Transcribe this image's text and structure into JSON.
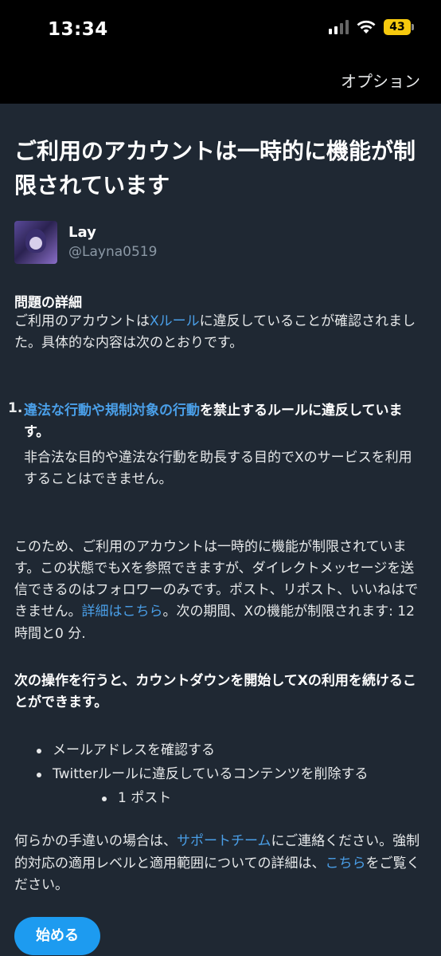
{
  "status": {
    "time": "13:34",
    "battery": "43"
  },
  "header": {
    "options_label": "オプション"
  },
  "title": "ご利用のアカウントは一時的に機能が制限されています",
  "profile": {
    "display_name": "Lay",
    "handle": "@Layna0519"
  },
  "details": {
    "heading": "問題の詳細",
    "text_before": "ご利用のアカウントは",
    "rules_link": "Xルール",
    "text_after": "に違反していることが確認されました。具体的な内容は次のとおりです。"
  },
  "violation": {
    "number": "1.",
    "link": "違法な行動や規制対象の行動",
    "strong_rest": "を禁止するルールに違反しています。",
    "description": "非合法な目的や違法な行動を助長する目的でXのサービスを利用することはできません。"
  },
  "restriction": {
    "text_before": "このため、ご利用のアカウントは一時的に機能が制限されています。この状態でもXを参照できますが、ダイレクトメッセージを送信できるのはフォロワーのみです。ポスト、リポスト、いいねはできません。",
    "details_link": "詳細はこちら",
    "text_after": "。次の期間、Xの機能が制限されます: 12 時間と0 分."
  },
  "action_heading": "次の操作を行うと、カウントダウンを開始してXの利用を続けることができます。",
  "actions": {
    "verify_email": "メールアドレスを確認する",
    "delete_content": "Twitterルールに違反しているコンテンツを削除する",
    "post_count": "1 ポスト"
  },
  "contact": {
    "text1": "何らかの手違いの場合は、",
    "support_link": "サポートチーム",
    "text2": "にご連絡ください。強制的対応の適用レベルと適用範囲についての詳細は、",
    "here_link": "こちら",
    "text3": "をご覧ください。"
  },
  "start_button": "始める"
}
